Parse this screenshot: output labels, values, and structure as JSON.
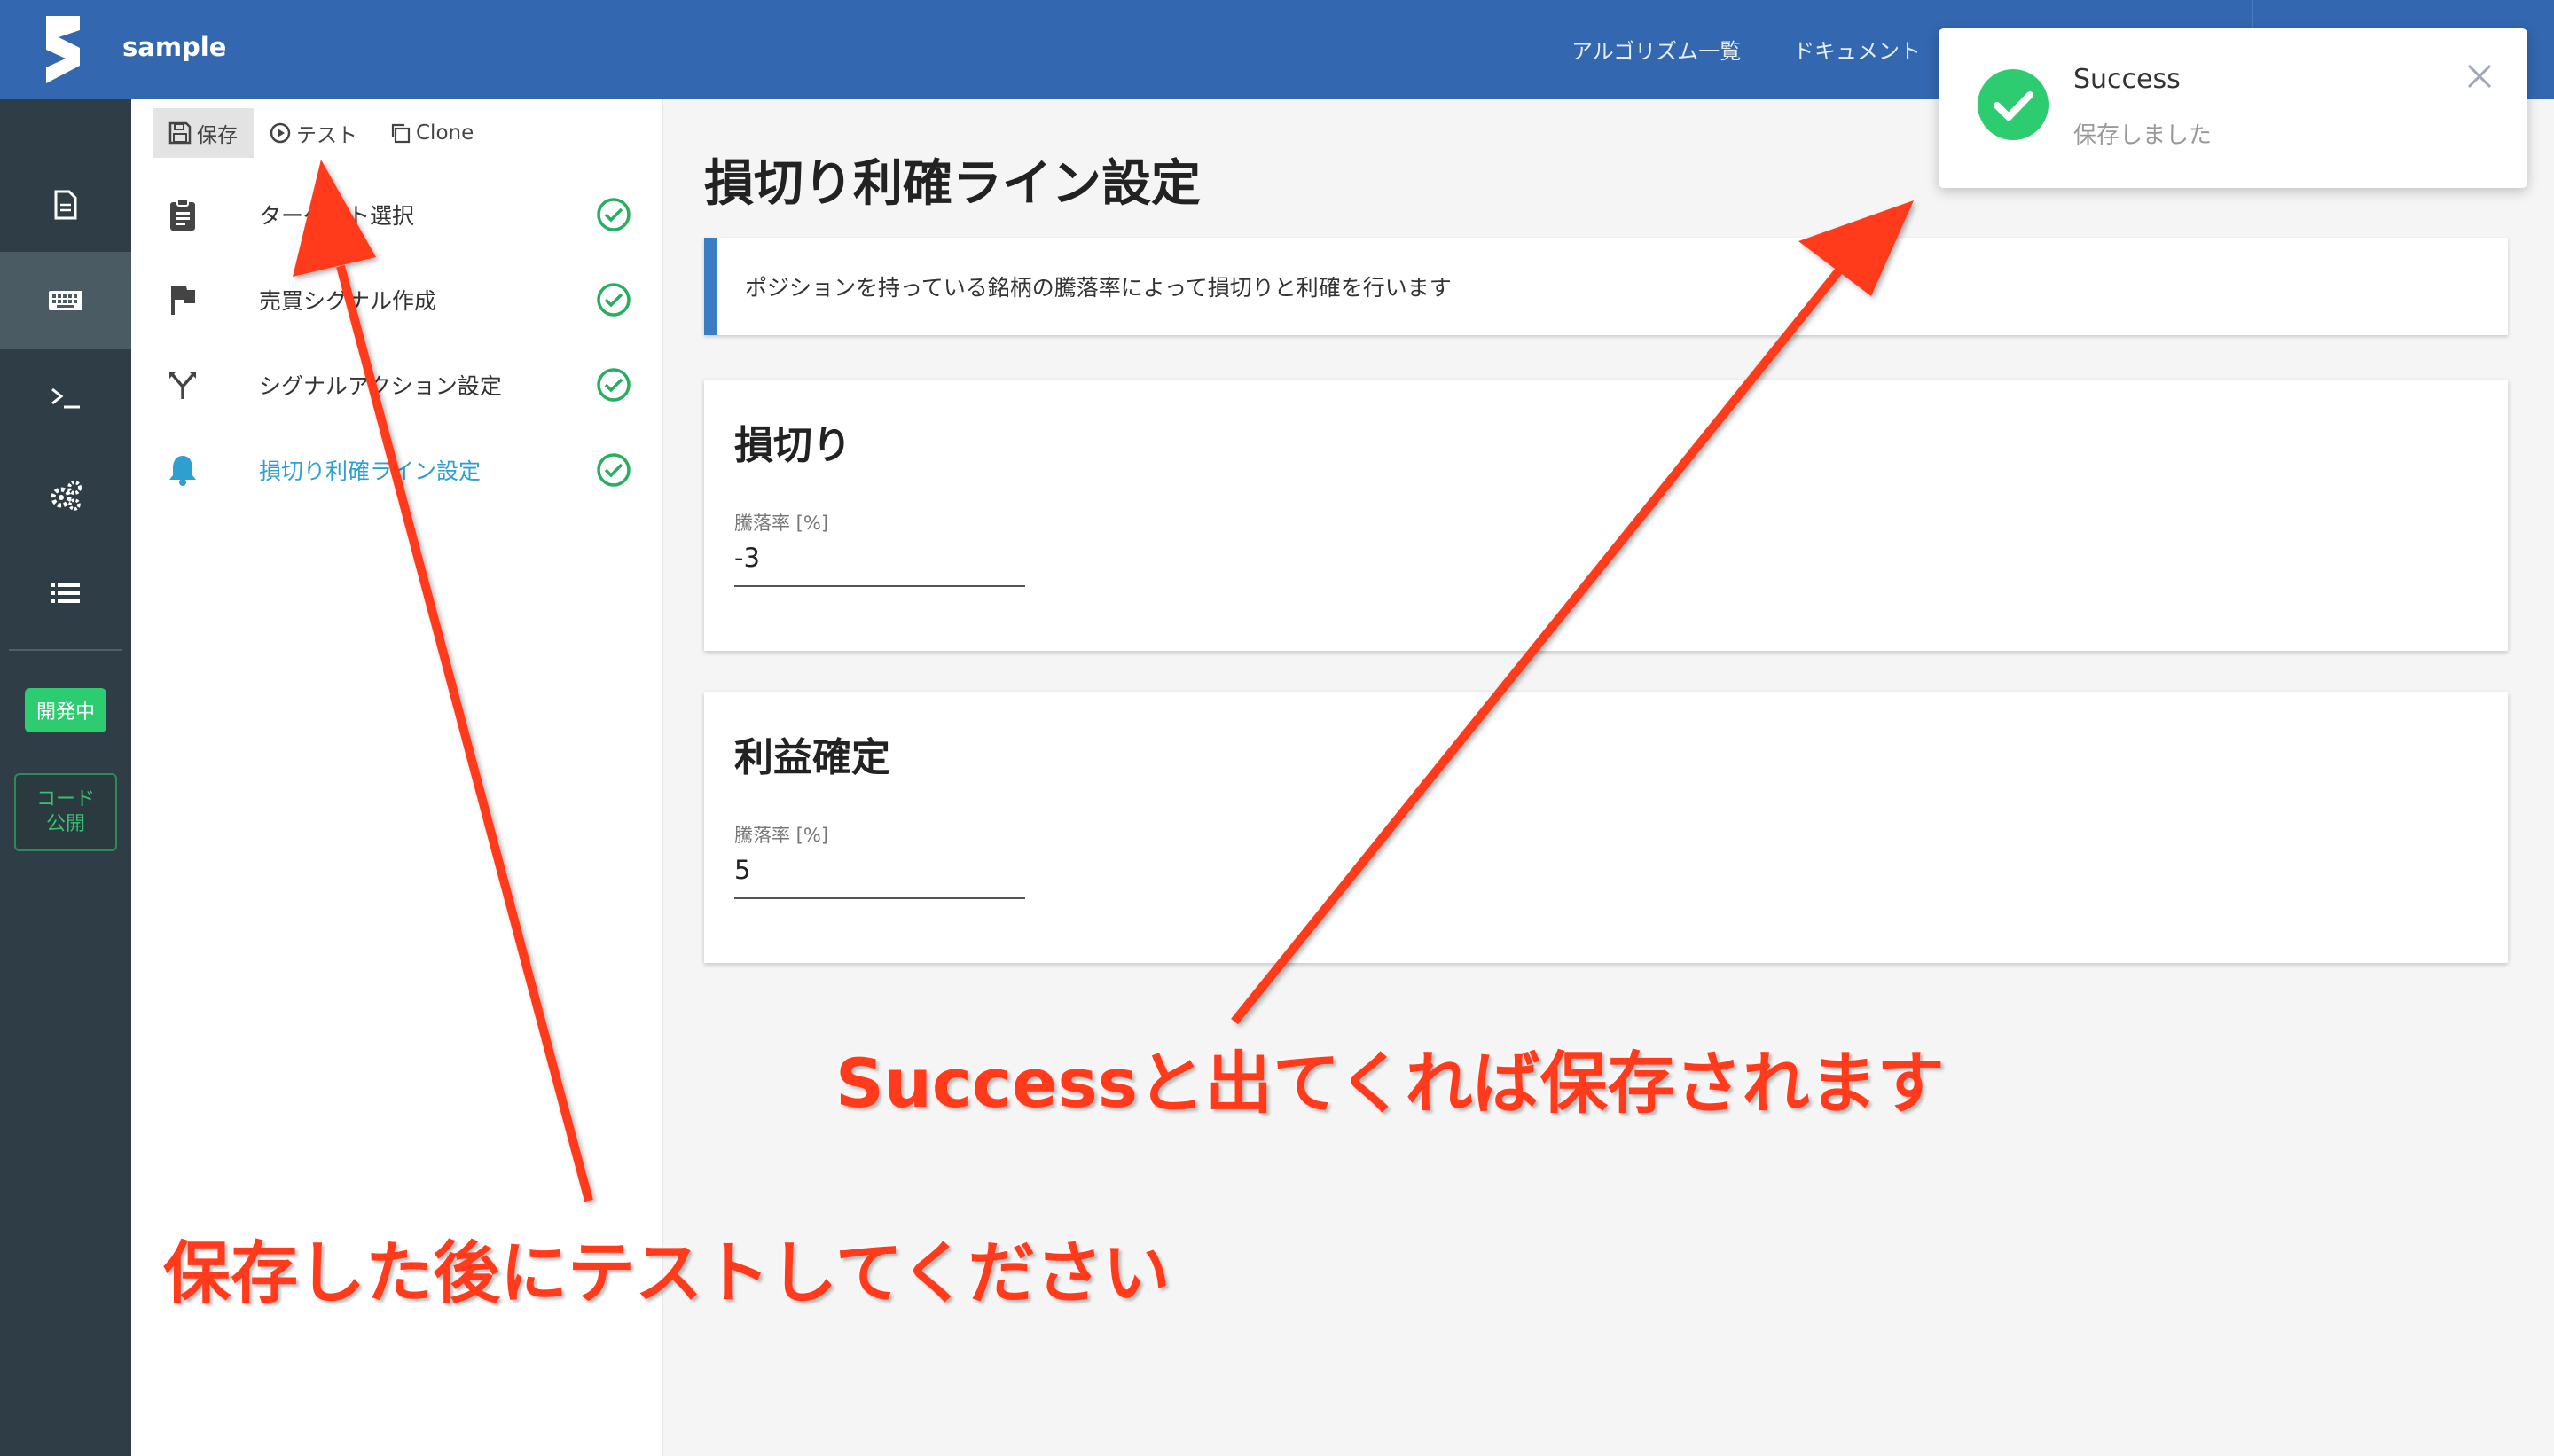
{
  "header": {
    "app_name": "sample",
    "nav": [
      "アルゴリズム一覧",
      "ドキュメント"
    ],
    "brand_color": "#3367b0"
  },
  "sidebar": {
    "items": [
      {
        "icon": "document-icon",
        "active": false
      },
      {
        "icon": "keyboard-icon",
        "active": true
      },
      {
        "icon": "terminal-icon",
        "active": false
      },
      {
        "icon": "gears-icon",
        "active": false
      },
      {
        "icon": "list-icon",
        "active": false
      }
    ],
    "status_badge": "開発中",
    "code_badge_line1": "コード",
    "code_badge_line2": "公開"
  },
  "toolbar": {
    "save_label": "保存",
    "test_label": "テスト",
    "clone_label": "Clone"
  },
  "steps": [
    {
      "label": "ターゲット選択",
      "icon": "clipboard-icon",
      "done": true,
      "active": false
    },
    {
      "label": "売買シグナル作成",
      "icon": "flag-icon",
      "done": true,
      "active": false
    },
    {
      "label": "シグナルアクション設定",
      "icon": "fork-icon",
      "done": true,
      "active": false
    },
    {
      "label": "損切り利確ライン設定",
      "icon": "bell-icon",
      "done": true,
      "active": true
    }
  ],
  "main": {
    "title": "損切り利確ライン設定",
    "info": "ポジションを持っている銘柄の騰落率によって損切りと利確を行います",
    "stop_loss": {
      "heading": "損切り",
      "field_label": "騰落率 [%]",
      "value": "-3"
    },
    "take_profit": {
      "heading": "利益確定",
      "field_label": "騰落率 [%]",
      "value": "5"
    }
  },
  "toast": {
    "title": "Success",
    "message": "保存しました"
  },
  "annotations": {
    "success_note": "Successと出てくれば保存されます",
    "test_note": "保存した後にテストしてください"
  },
  "colors": {
    "success_green": "#2ecc71",
    "annotation_red": "#ff3b1c",
    "active_step": "#2f9fd0"
  }
}
